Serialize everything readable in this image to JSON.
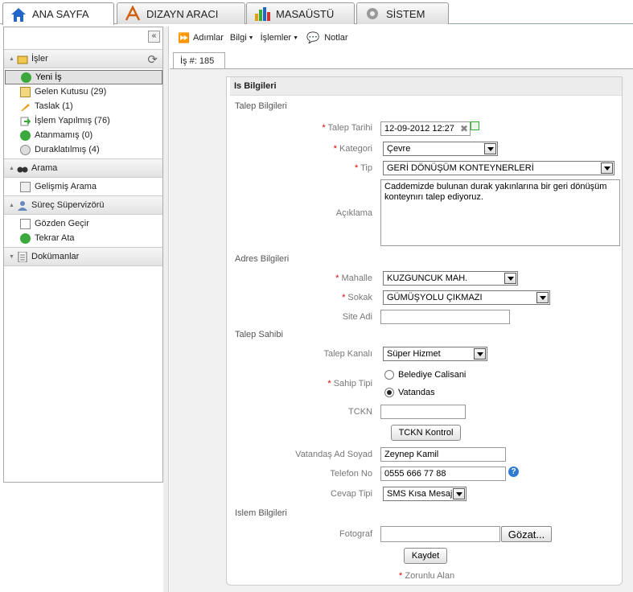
{
  "tabs": [
    {
      "label": "ANA SAYFA",
      "icon": "home-icon"
    },
    {
      "label": "DIZAYN ARACI",
      "icon": "design-tool-icon"
    },
    {
      "label": "MASAÜSTÜ",
      "icon": "bar-chart-icon"
    },
    {
      "label": "SİSTEM",
      "icon": "gear-icon"
    }
  ],
  "sidebar": {
    "collapse_label": "«",
    "sections": [
      {
        "label": "İşler",
        "icon": "folder-icon"
      },
      {
        "label": "Arama",
        "icon": "binoculars-icon"
      },
      {
        "label": "Süreç Süpervizörü",
        "icon": "user-icon"
      },
      {
        "label": "Dokümanlar",
        "icon": "document-icon"
      }
    ],
    "work_items": [
      {
        "label": "Yeni İş",
        "icon": "add-icon"
      },
      {
        "label": "Gelen Kutusu (29)",
        "icon": "inbox-icon"
      },
      {
        "label": "Taslak (1)",
        "icon": "pencil-icon"
      },
      {
        "label": "İşlem Yapılmış (76)",
        "icon": "forward-icon"
      },
      {
        "label": "Atanmamış (0)",
        "icon": "refresh-icon"
      },
      {
        "label": "Duraklatılmış (4)",
        "icon": "pause-icon"
      }
    ],
    "search_items": [
      {
        "label": "Gelişmiş Arama",
        "icon": "advanced-search-icon"
      }
    ],
    "supervisor_items": [
      {
        "label": "Gözden Geçir",
        "icon": "review-icon"
      },
      {
        "label": "Tekrar Ata",
        "icon": "reassign-icon"
      }
    ]
  },
  "toolbar": {
    "steps": "Adımlar",
    "info": "Bilgi",
    "actions": "İşlemler",
    "notes": "Notlar"
  },
  "doc_tab": "İş #: 185",
  "form": {
    "title": "Is Bilgileri",
    "groups": {
      "request": "Talep Bilgileri",
      "address": "Adres Bilgileri",
      "owner": "Talep Sahibi",
      "process": "Islem Bilgileri"
    },
    "required_mark": "*",
    "fields": {
      "date": {
        "label": "Talep Tarihi",
        "value": "12-09-2012 12:27"
      },
      "category": {
        "label": "Kategori",
        "value": "Çevre"
      },
      "type": {
        "label": "Tip",
        "value": "GERİ DÖNÜŞÜM KONTEYNERLERİ"
      },
      "description": {
        "label": "Açıklama",
        "value": "Caddemizde bulunan durak yakınlarına bir geri dönüşüm konteynırı talep ediyoruz."
      },
      "district": {
        "label": "Mahalle",
        "value": "KUZGUNCUK MAH."
      },
      "street": {
        "label": "Sokak",
        "value": "GÜMÜŞYOLU ÇIKMAZI"
      },
      "site": {
        "label": "Site Adi",
        "value": ""
      },
      "channel": {
        "label": "Talep Kanalı",
        "value": "Süper Hizmet"
      },
      "owner_type": {
        "label": "Sahip Tipi",
        "options": [
          "Belediye Calisani",
          "Vatandas"
        ],
        "selected": "Vatandas"
      },
      "tckn": {
        "label": "TCKN",
        "value": ""
      },
      "tckn_button": "TCKN Kontrol",
      "name": {
        "label": "Vatandaş Ad Soyad",
        "value": "Zeynep Kamil"
      },
      "phone": {
        "label": "Telefon No",
        "value": "0555 666 77 88"
      },
      "reply": {
        "label": "Cevap Tipi",
        "value": "SMS Kısa Mesaj"
      },
      "photo": {
        "label": "Fotograf",
        "value": ""
      },
      "browse_button": "Gözat...",
      "save_button": "Kaydet",
      "required_note": "Zorunlu Alan"
    }
  },
  "colors": {
    "accent_green": "#3aa83a",
    "required": "#dd0000",
    "home_blue": "#2266cc"
  }
}
